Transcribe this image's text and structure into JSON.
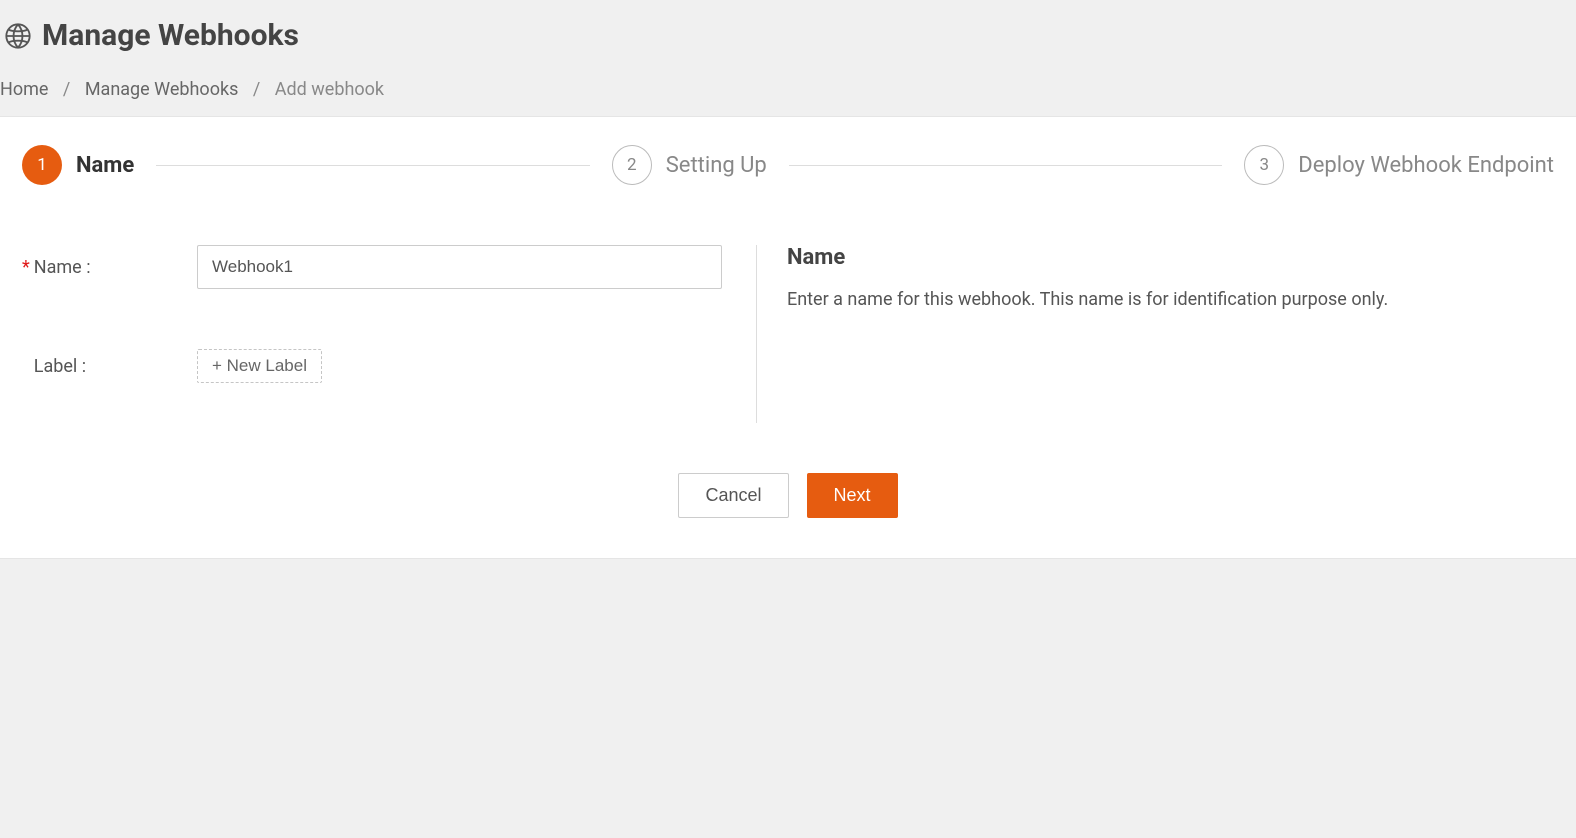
{
  "header": {
    "title": "Manage Webhooks"
  },
  "breadcrumb": {
    "home": "Home",
    "middle": "Manage Webhooks",
    "current": "Add webhook"
  },
  "stepper": {
    "steps": [
      {
        "num": "1",
        "label": "Name"
      },
      {
        "num": "2",
        "label": "Setting Up"
      },
      {
        "num": "3",
        "label": "Deploy Webhook Endpoint"
      }
    ]
  },
  "form": {
    "name_label": "Name :",
    "name_value": "Webhook1",
    "label_label": "Label :",
    "new_label_button": "+ New Label"
  },
  "help": {
    "title": "Name",
    "text": "Enter a name for this webhook. This name is for identification purpose only."
  },
  "buttons": {
    "cancel": "Cancel",
    "next": "Next"
  }
}
